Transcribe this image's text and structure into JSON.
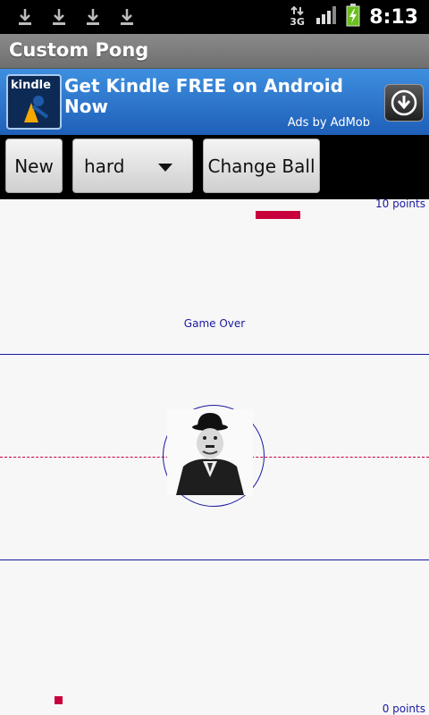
{
  "status_bar": {
    "time": "8:13",
    "network": "3G",
    "icons": [
      "download-icon",
      "download-icon",
      "download-icon",
      "download-icon",
      "network-3g-icon",
      "signal-icon",
      "battery-charging-icon"
    ]
  },
  "app": {
    "title": "Custom Pong"
  },
  "ad": {
    "logo_text": "kindle",
    "headline": "Get Kindle FREE on Android Now",
    "attribution": "Ads by AdMob",
    "action_icon": "download-circle-icon"
  },
  "toolbar": {
    "new_label": "New",
    "difficulty_value": "hard",
    "change_ball_label": "Change Ball"
  },
  "game": {
    "top_score": "10 points",
    "bottom_score": "0 points",
    "status_text": "Game Over",
    "colors": {
      "paddle": "#c8003c",
      "lines": "#1a1aa0",
      "background": "#f7f7f7"
    }
  }
}
